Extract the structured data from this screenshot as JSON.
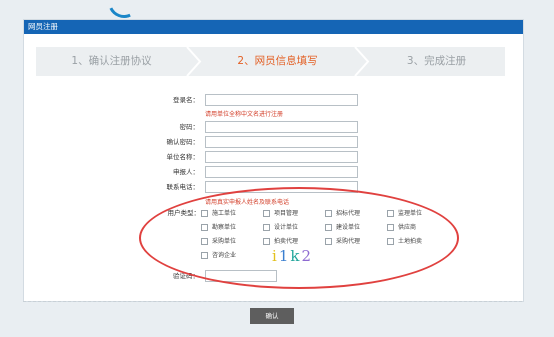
{
  "panel_title": "网员注册",
  "steps": [
    {
      "label": "1、确认注册协议",
      "active": false
    },
    {
      "label": "2、网员信息填写",
      "active": true
    },
    {
      "label": "3、完成注册",
      "active": false
    }
  ],
  "fields": {
    "login_label": "登录名：",
    "login_hint": "请用单位全称中文名进行注册",
    "password_label": "密码：",
    "confirm_password_label": "确认密码：",
    "company_label": "单位名称：",
    "applicant_label": "申报人：",
    "phone_label": "联系电话：",
    "phone_hint": "请用真实申报人姓名及联系电话",
    "user_type_label": "用户类型：",
    "captcha_label": "验证码："
  },
  "user_types": [
    [
      "施工单位",
      "项目管理",
      "招标代理",
      "监理单位"
    ],
    [
      "勘察单位",
      "设计单位",
      "建设单位",
      "供应商"
    ],
    [
      "采购单位",
      "拍卖代理",
      "采购代理",
      "土地拍卖"
    ],
    [
      "咨询企业"
    ]
  ],
  "captcha": {
    "chars": [
      "i",
      "1",
      "k",
      "2"
    ],
    "colors": [
      "#e3c11e",
      "#3b7fd0",
      "#22a59b",
      "#8e6ad1"
    ]
  },
  "confirm_label": "确认",
  "colors": {
    "header": "#1565b5",
    "active_step": "#e35f24",
    "hint": "#d23b25",
    "annotation": "#e0413f"
  }
}
